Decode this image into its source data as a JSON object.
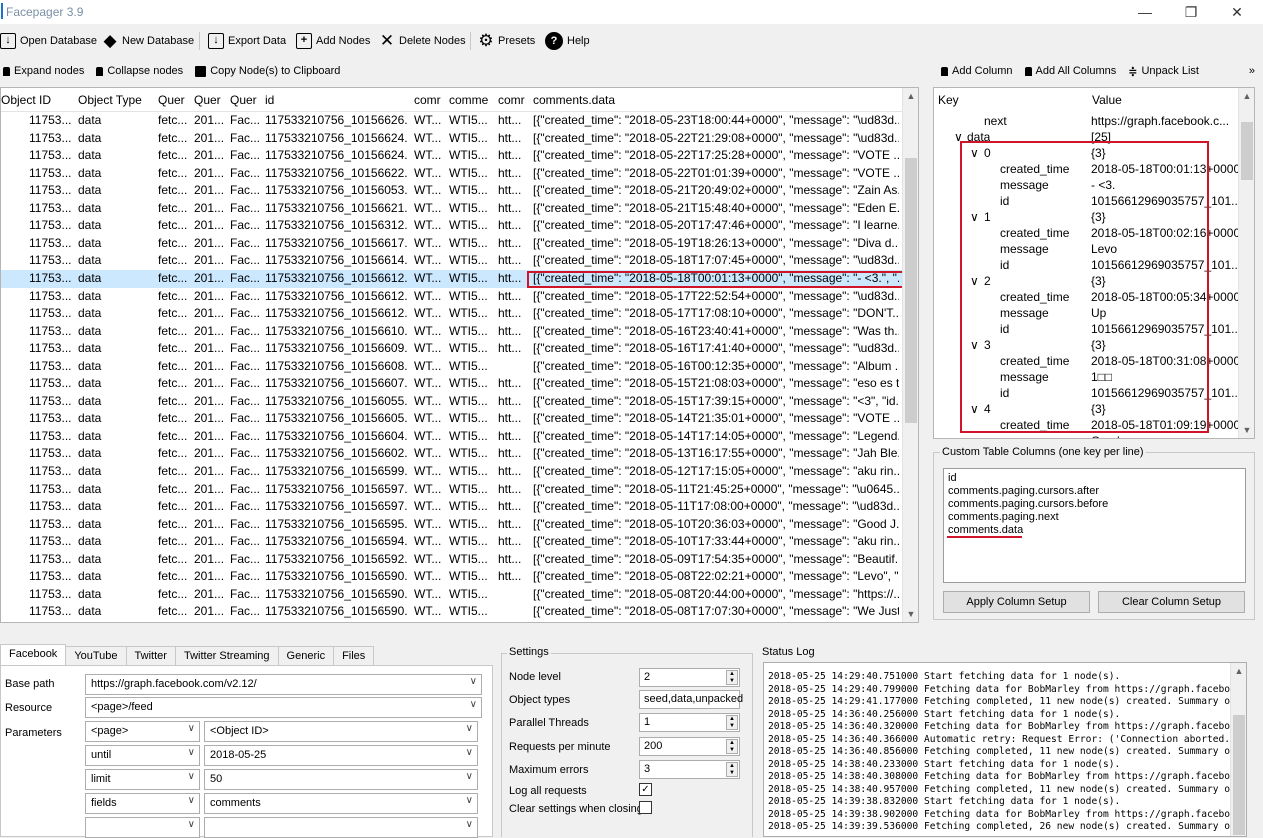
{
  "window": {
    "title": "Facepager 3.9",
    "minimize_icon": "—",
    "restore_icon": "❐",
    "close_icon": "✕"
  },
  "toolbar": {
    "open_database": "Open Database",
    "new_database": "New Database",
    "export_data": "Export Data",
    "add_nodes": "Add Nodes",
    "delete_nodes": "Delete Nodes",
    "presets": "Presets",
    "help": "Help"
  },
  "subbar": {
    "expand": "Expand nodes",
    "collapse": "Collapse nodes",
    "copy": "Copy Node(s) to Clipboard"
  },
  "table": {
    "headers": [
      "Object ID",
      "Object Type",
      "Quer",
      "Quer",
      "Quer",
      "id",
      "comr",
      "comme",
      "comr",
      "comments.data"
    ],
    "rows": [
      [
        "11753...",
        "data",
        "fetc...",
        "201...",
        "Fac...",
        "117533210756_10156626...",
        "WT...",
        "WTI5...",
        "htt...",
        "[{\"created_time\": \"2018-05-23T18:00:44+0000\", \"message\": \"\\ud83d..."
      ],
      [
        "11753...",
        "data",
        "fetc...",
        "201...",
        "Fac...",
        "117533210756_10156624...",
        "WT...",
        "WTI5...",
        "htt...",
        "[{\"created_time\": \"2018-05-22T21:29:08+0000\", \"message\": \"\\ud83d..."
      ],
      [
        "11753...",
        "data",
        "fetc...",
        "201...",
        "Fac...",
        "117533210756_10156624...",
        "WT...",
        "WTI5...",
        "htt...",
        "[{\"created_time\": \"2018-05-22T17:25:28+0000\", \"message\": \"VOTE ..."
      ],
      [
        "11753...",
        "data",
        "fetc...",
        "201...",
        "Fac...",
        "117533210756_10156622...",
        "WT...",
        "WTI5...",
        "htt...",
        "[{\"created_time\": \"2018-05-22T01:01:39+0000\", \"message\": \"VOTE ..."
      ],
      [
        "11753...",
        "data",
        "fetc...",
        "201...",
        "Fac...",
        "117533210756_10156053...",
        "WT...",
        "WTI5...",
        "htt...",
        "[{\"created_time\": \"2018-05-21T20:49:02+0000\", \"message\": \"Zain As..."
      ],
      [
        "11753...",
        "data",
        "fetc...",
        "201...",
        "Fac...",
        "117533210756_10156621...",
        "WT...",
        "WTI5...",
        "htt...",
        "[{\"created_time\": \"2018-05-21T15:48:40+0000\", \"message\": \"Eden E..."
      ],
      [
        "11753...",
        "data",
        "fetc...",
        "201...",
        "Fac...",
        "117533210756_10156312...",
        "WT...",
        "WTI5...",
        "htt...",
        "[{\"created_time\": \"2018-05-20T17:47:46+0000\", \"message\": \"I learne..."
      ],
      [
        "11753...",
        "data",
        "fetc...",
        "201...",
        "Fac...",
        "117533210756_10156617...",
        "WT...",
        "WTI5...",
        "htt...",
        "[{\"created_time\": \"2018-05-19T18:26:13+0000\", \"message\": \"Diva d..."
      ],
      [
        "11753...",
        "data",
        "fetc...",
        "201...",
        "Fac...",
        "117533210756_10156614...",
        "WT...",
        "WTI5...",
        "htt...",
        "[{\"created_time\": \"2018-05-18T17:07:45+0000\", \"message\": \"\\ud83d..."
      ],
      [
        "11753...",
        "data",
        "fetc...",
        "201...",
        "Fac...",
        "117533210756_10156612...",
        "WT...",
        "WTI5...",
        "htt...",
        "[{\"created_time\": \"2018-05-18T00:01:13+0000\", \"message\": \"- <3.\", \"..."
      ],
      [
        "11753...",
        "data",
        "fetc...",
        "201...",
        "Fac...",
        "117533210756_10156612...",
        "WT...",
        "WTI5...",
        "htt...",
        "[{\"created_time\": \"2018-05-17T22:52:54+0000\", \"message\": \"\\ud83d..."
      ],
      [
        "11753...",
        "data",
        "fetc...",
        "201...",
        "Fac...",
        "117533210756_10156612...",
        "WT...",
        "WTI5...",
        "htt...",
        "[{\"created_time\": \"2018-05-17T17:08:10+0000\", \"message\": \"DON'T..."
      ],
      [
        "11753...",
        "data",
        "fetc...",
        "201...",
        "Fac...",
        "117533210756_10156610...",
        "WT...",
        "WTI5...",
        "htt...",
        "[{\"created_time\": \"2018-05-16T23:40:41+0000\", \"message\": \"Was th..."
      ],
      [
        "11753...",
        "data",
        "fetc...",
        "201...",
        "Fac...",
        "117533210756_10156609...",
        "WT...",
        "WTI5...",
        "htt...",
        "[{\"created_time\": \"2018-05-16T17:41:40+0000\", \"message\": \"\\ud83d..."
      ],
      [
        "11753...",
        "data",
        "fetc...",
        "201...",
        "Fac...",
        "117533210756_10156608...",
        "WT...",
        "WTI5...",
        "",
        "[{\"created_time\": \"2018-05-16T00:12:35+0000\", \"message\": \"Album ..."
      ],
      [
        "11753...",
        "data",
        "fetc...",
        "201...",
        "Fac...",
        "117533210756_10156607...",
        "WT...",
        "WTI5...",
        "htt...",
        "[{\"created_time\": \"2018-05-15T21:08:03+0000\", \"message\": \"eso es t..."
      ],
      [
        "11753...",
        "data",
        "fetc...",
        "201...",
        "Fac...",
        "117533210756_10156055...",
        "WT...",
        "WTI5...",
        "htt...",
        "[{\"created_time\": \"2018-05-15T17:39:15+0000\", \"message\": \"<3\", \"id..."
      ],
      [
        "11753...",
        "data",
        "fetc...",
        "201...",
        "Fac...",
        "117533210756_10156605...",
        "WT...",
        "WTI5...",
        "htt...",
        "[{\"created_time\": \"2018-05-14T21:35:01+0000\", \"message\": \"VOTE ..."
      ],
      [
        "11753...",
        "data",
        "fetc...",
        "201...",
        "Fac...",
        "117533210756_10156604...",
        "WT...",
        "WTI5...",
        "htt...",
        "[{\"created_time\": \"2018-05-14T17:14:05+0000\", \"message\": \"Legend..."
      ],
      [
        "11753...",
        "data",
        "fetc...",
        "201...",
        "Fac...",
        "117533210756_10156602...",
        "WT...",
        "WTI5...",
        "htt...",
        "[{\"created_time\": \"2018-05-13T16:17:55+0000\", \"message\": \"Jah Ble..."
      ],
      [
        "11753...",
        "data",
        "fetc...",
        "201...",
        "Fac...",
        "117533210756_10156599...",
        "WT...",
        "WTI5...",
        "htt...",
        "[{\"created_time\": \"2018-05-12T17:15:05+0000\", \"message\": \"aku rin..."
      ],
      [
        "11753...",
        "data",
        "fetc...",
        "201...",
        "Fac...",
        "117533210756_10156597...",
        "WT...",
        "WTI5...",
        "htt...",
        "[{\"created_time\": \"2018-05-11T21:45:25+0000\", \"message\": \"\\u0645..."
      ],
      [
        "11753...",
        "data",
        "fetc...",
        "201...",
        "Fac...",
        "117533210756_10156597...",
        "WT...",
        "WTI5...",
        "htt...",
        "[{\"created_time\": \"2018-05-11T17:08:00+0000\", \"message\": \"\\ud83d..."
      ],
      [
        "11753...",
        "data",
        "fetc...",
        "201...",
        "Fac...",
        "117533210756_10156595...",
        "WT...",
        "WTI5...",
        "htt...",
        "[{\"created_time\": \"2018-05-10T20:36:03+0000\", \"message\": \"Good J..."
      ],
      [
        "11753...",
        "data",
        "fetc...",
        "201...",
        "Fac...",
        "117533210756_10156594...",
        "WT...",
        "WTI5...",
        "htt...",
        "[{\"created_time\": \"2018-05-10T17:33:44+0000\", \"message\": \"aku rin..."
      ],
      [
        "11753...",
        "data",
        "fetc...",
        "201...",
        "Fac...",
        "117533210756_10156592...",
        "WT...",
        "WTI5...",
        "htt...",
        "[{\"created_time\": \"2018-05-09T17:54:35+0000\", \"message\": \"Beautif..."
      ],
      [
        "11753...",
        "data",
        "fetc...",
        "201...",
        "Fac...",
        "117533210756_10156590...",
        "WT...",
        "WTI5...",
        "htt...",
        "[{\"created_time\": \"2018-05-08T22:02:21+0000\", \"message\": \"Levo\", \"..."
      ],
      [
        "11753...",
        "data",
        "fetc...",
        "201...",
        "Fac...",
        "117533210756_10156590...",
        "WT...",
        "WTI5...",
        "",
        "[{\"created_time\": \"2018-05-08T20:44:00+0000\", \"message\": \"https://..."
      ],
      [
        "11753...",
        "data",
        "fetc...",
        "201...",
        "Fac...",
        "117533210756_10156590...",
        "WT...",
        "WTI5...",
        "",
        "[{\"created_time\": \"2018-05-08T17:07:30+0000\", \"message\": \"We Just..."
      ]
    ],
    "selected_row": 9
  },
  "right_toolbar": {
    "add_column": "Add Column",
    "add_all_columns": "Add All Columns",
    "unpack_list": "Unpack List",
    "more": "»"
  },
  "tree": {
    "key_header": "Key",
    "value_header": "Value",
    "rows": [
      {
        "key": "next",
        "value": "https://graph.facebook.c...",
        "indent": 0,
        "arrow": ""
      },
      {
        "key": "data",
        "value": "[25]",
        "indent": 0,
        "arrow": "∨"
      },
      {
        "key": "0",
        "value": "{3}",
        "indent": 1,
        "arrow": "∨"
      },
      {
        "key": "created_time",
        "value": "2018-05-18T00:01:13+0000",
        "indent": 2,
        "arrow": ""
      },
      {
        "key": "message",
        "value": "- <3.",
        "indent": 2,
        "arrow": ""
      },
      {
        "key": "id",
        "value": "10156612969035757_101...",
        "indent": 2,
        "arrow": ""
      },
      {
        "key": "1",
        "value": "{3}",
        "indent": 1,
        "arrow": "∨"
      },
      {
        "key": "created_time",
        "value": "2018-05-18T00:02:16+0000",
        "indent": 2,
        "arrow": ""
      },
      {
        "key": "message",
        "value": "Levo",
        "indent": 2,
        "arrow": ""
      },
      {
        "key": "id",
        "value": "10156612969035757_101...",
        "indent": 2,
        "arrow": ""
      },
      {
        "key": "2",
        "value": "{3}",
        "indent": 1,
        "arrow": "∨"
      },
      {
        "key": "created_time",
        "value": "2018-05-18T00:05:34+0000",
        "indent": 2,
        "arrow": ""
      },
      {
        "key": "message",
        "value": "Up",
        "indent": 2,
        "arrow": ""
      },
      {
        "key": "id",
        "value": "10156612969035757_101...",
        "indent": 2,
        "arrow": ""
      },
      {
        "key": "3",
        "value": "{3}",
        "indent": 1,
        "arrow": "∨"
      },
      {
        "key": "created_time",
        "value": "2018-05-18T00:31:08+0000",
        "indent": 2,
        "arrow": ""
      },
      {
        "key": "message",
        "value": "1□□",
        "indent": 2,
        "arrow": ""
      },
      {
        "key": "id",
        "value": "10156612969035757_101...",
        "indent": 2,
        "arrow": ""
      },
      {
        "key": "4",
        "value": "{3}",
        "indent": 1,
        "arrow": "∨"
      },
      {
        "key": "created_time",
        "value": "2018-05-18T01:09:19+0000",
        "indent": 2,
        "arrow": ""
      },
      {
        "key": "message",
        "value": "One love",
        "indent": 2,
        "arrow": ""
      }
    ]
  },
  "custom_columns": {
    "legend": "Custom Table Columns (one key per line)",
    "lines": [
      "id",
      "comments.paging.cursors.after",
      "comments.paging.cursors.before",
      "comments.paging.next",
      "comments.data"
    ],
    "apply": "Apply Column Setup",
    "clear": "Clear Column Setup"
  },
  "tabs": [
    "Facebook",
    "YouTube",
    "Twitter",
    "Twitter Streaming",
    "Generic",
    "Files"
  ],
  "form": {
    "base_path_label": "Base path",
    "base_path": "https://graph.facebook.com/v2.12/",
    "resource_label": "Resource",
    "resource": "<page>/feed",
    "parameters_label": "Parameters",
    "params": [
      {
        "key": "<page>",
        "value": "<Object ID>"
      },
      {
        "key": "until",
        "value": "2018-05-25"
      },
      {
        "key": "limit",
        "value": "50"
      },
      {
        "key": "fields",
        "value": "comments"
      },
      {
        "key": "",
        "value": ""
      }
    ]
  },
  "settings": {
    "legend": "Settings",
    "node_level_label": "Node level",
    "node_level": "2",
    "object_types_label": "Object types",
    "object_types": "seed,data,unpacked",
    "parallel_label": "Parallel Threads",
    "parallel": "1",
    "rpm_label": "Requests per minute",
    "rpm": "200",
    "max_errors_label": "Maximum errors",
    "max_errors": "3",
    "log_all_label": "Log all requests",
    "log_all_checked": "✓",
    "clear_settings_label": "Clear settings when closing"
  },
  "status_log": {
    "legend": "Status Log",
    "lines": [
      "2018-05-25 14:29:40.751000 Start fetching data for 1 node(s).",
      "2018-05-25 14:29:40.799000 Fetching data for BobMarley from https://graph.facebook.com/v2.12/B",
      "2018-05-25 14:29:41.177000 Fetching completed, 11 new node(s) created. Summary of responses:",
      "2018-05-25 14:36:40.256000 Start fetching data for 1 node(s).",
      "2018-05-25 14:36:40.320000 Fetching data for BobMarley from https://graph.facebook.com/v2.12/B",
      "2018-05-25 14:36:40.366000 Automatic retry: Request Error: ('Connection aborted.', BadStatusLine(",
      "2018-05-25 14:36:40.856000 Fetching completed, 11 new node(s) created. Summary of responses:",
      "2018-05-25 14:38:40.233000 Start fetching data for 1 node(s).",
      "2018-05-25 14:38:40.308000 Fetching data for BobMarley from https://graph.facebook.com/v2.12/B",
      "2018-05-25 14:38:40.957000 Fetching completed, 11 new node(s) created. Summary of responses:",
      "2018-05-25 14:39:38.832000 Start fetching data for 1 node(s).",
      "2018-05-25 14:39:38.902000 Fetching data for BobMarley from https://graph.facebook.com/v2.12/B",
      "2018-05-25 14:39:39.536000 Fetching completed, 26 new node(s) created. Summary of responses:"
    ]
  },
  "colors": {
    "selected_row": "#cce8ff",
    "highlight_box": "#d0142a",
    "accent": "#1a73c9"
  }
}
